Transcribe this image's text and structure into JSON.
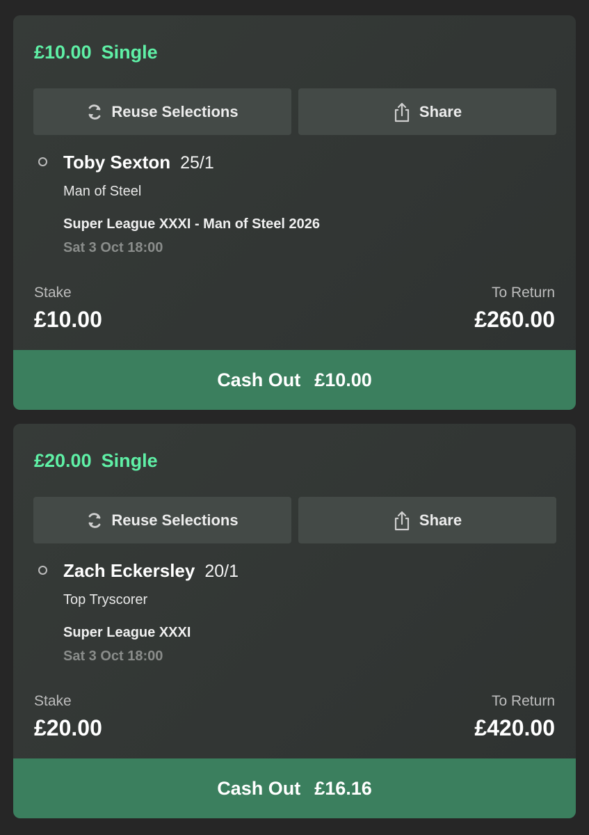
{
  "bets": [
    {
      "stake_header": "£10.00",
      "bet_type": "Single",
      "reuse_label": "Reuse Selections",
      "share_label": "Share",
      "selection": {
        "name": "Toby Sexton",
        "odds": "25/1",
        "market": "Man of Steel",
        "event": "Super League XXXI - Man of Steel 2026",
        "datetime": "Sat 3 Oct 18:00"
      },
      "stake_label": "Stake",
      "stake_value": "£10.00",
      "return_label": "To Return",
      "return_value": "£260.00",
      "cashout_label": "Cash Out",
      "cashout_value": "£10.00"
    },
    {
      "stake_header": "£20.00",
      "bet_type": "Single",
      "reuse_label": "Reuse Selections",
      "share_label": "Share",
      "selection": {
        "name": "Zach Eckersley",
        "odds": "20/1",
        "market": "Top Tryscorer",
        "event": "Super League XXXI",
        "datetime": "Sat 3 Oct 18:00"
      },
      "stake_label": "Stake",
      "stake_value": "£20.00",
      "return_label": "To Return",
      "return_value": "£420.00",
      "cashout_label": "Cash Out",
      "cashout_value": "£16.16"
    }
  ],
  "colors": {
    "background": "#262626",
    "card": "#343937",
    "accent_green": "#5ff0a6",
    "cashout_bg": "#3b7f5e",
    "button_bg": "#444a47"
  },
  "icons": {
    "reuse": "refresh-icon",
    "share": "share-icon",
    "selection": "radio-circle-icon"
  }
}
